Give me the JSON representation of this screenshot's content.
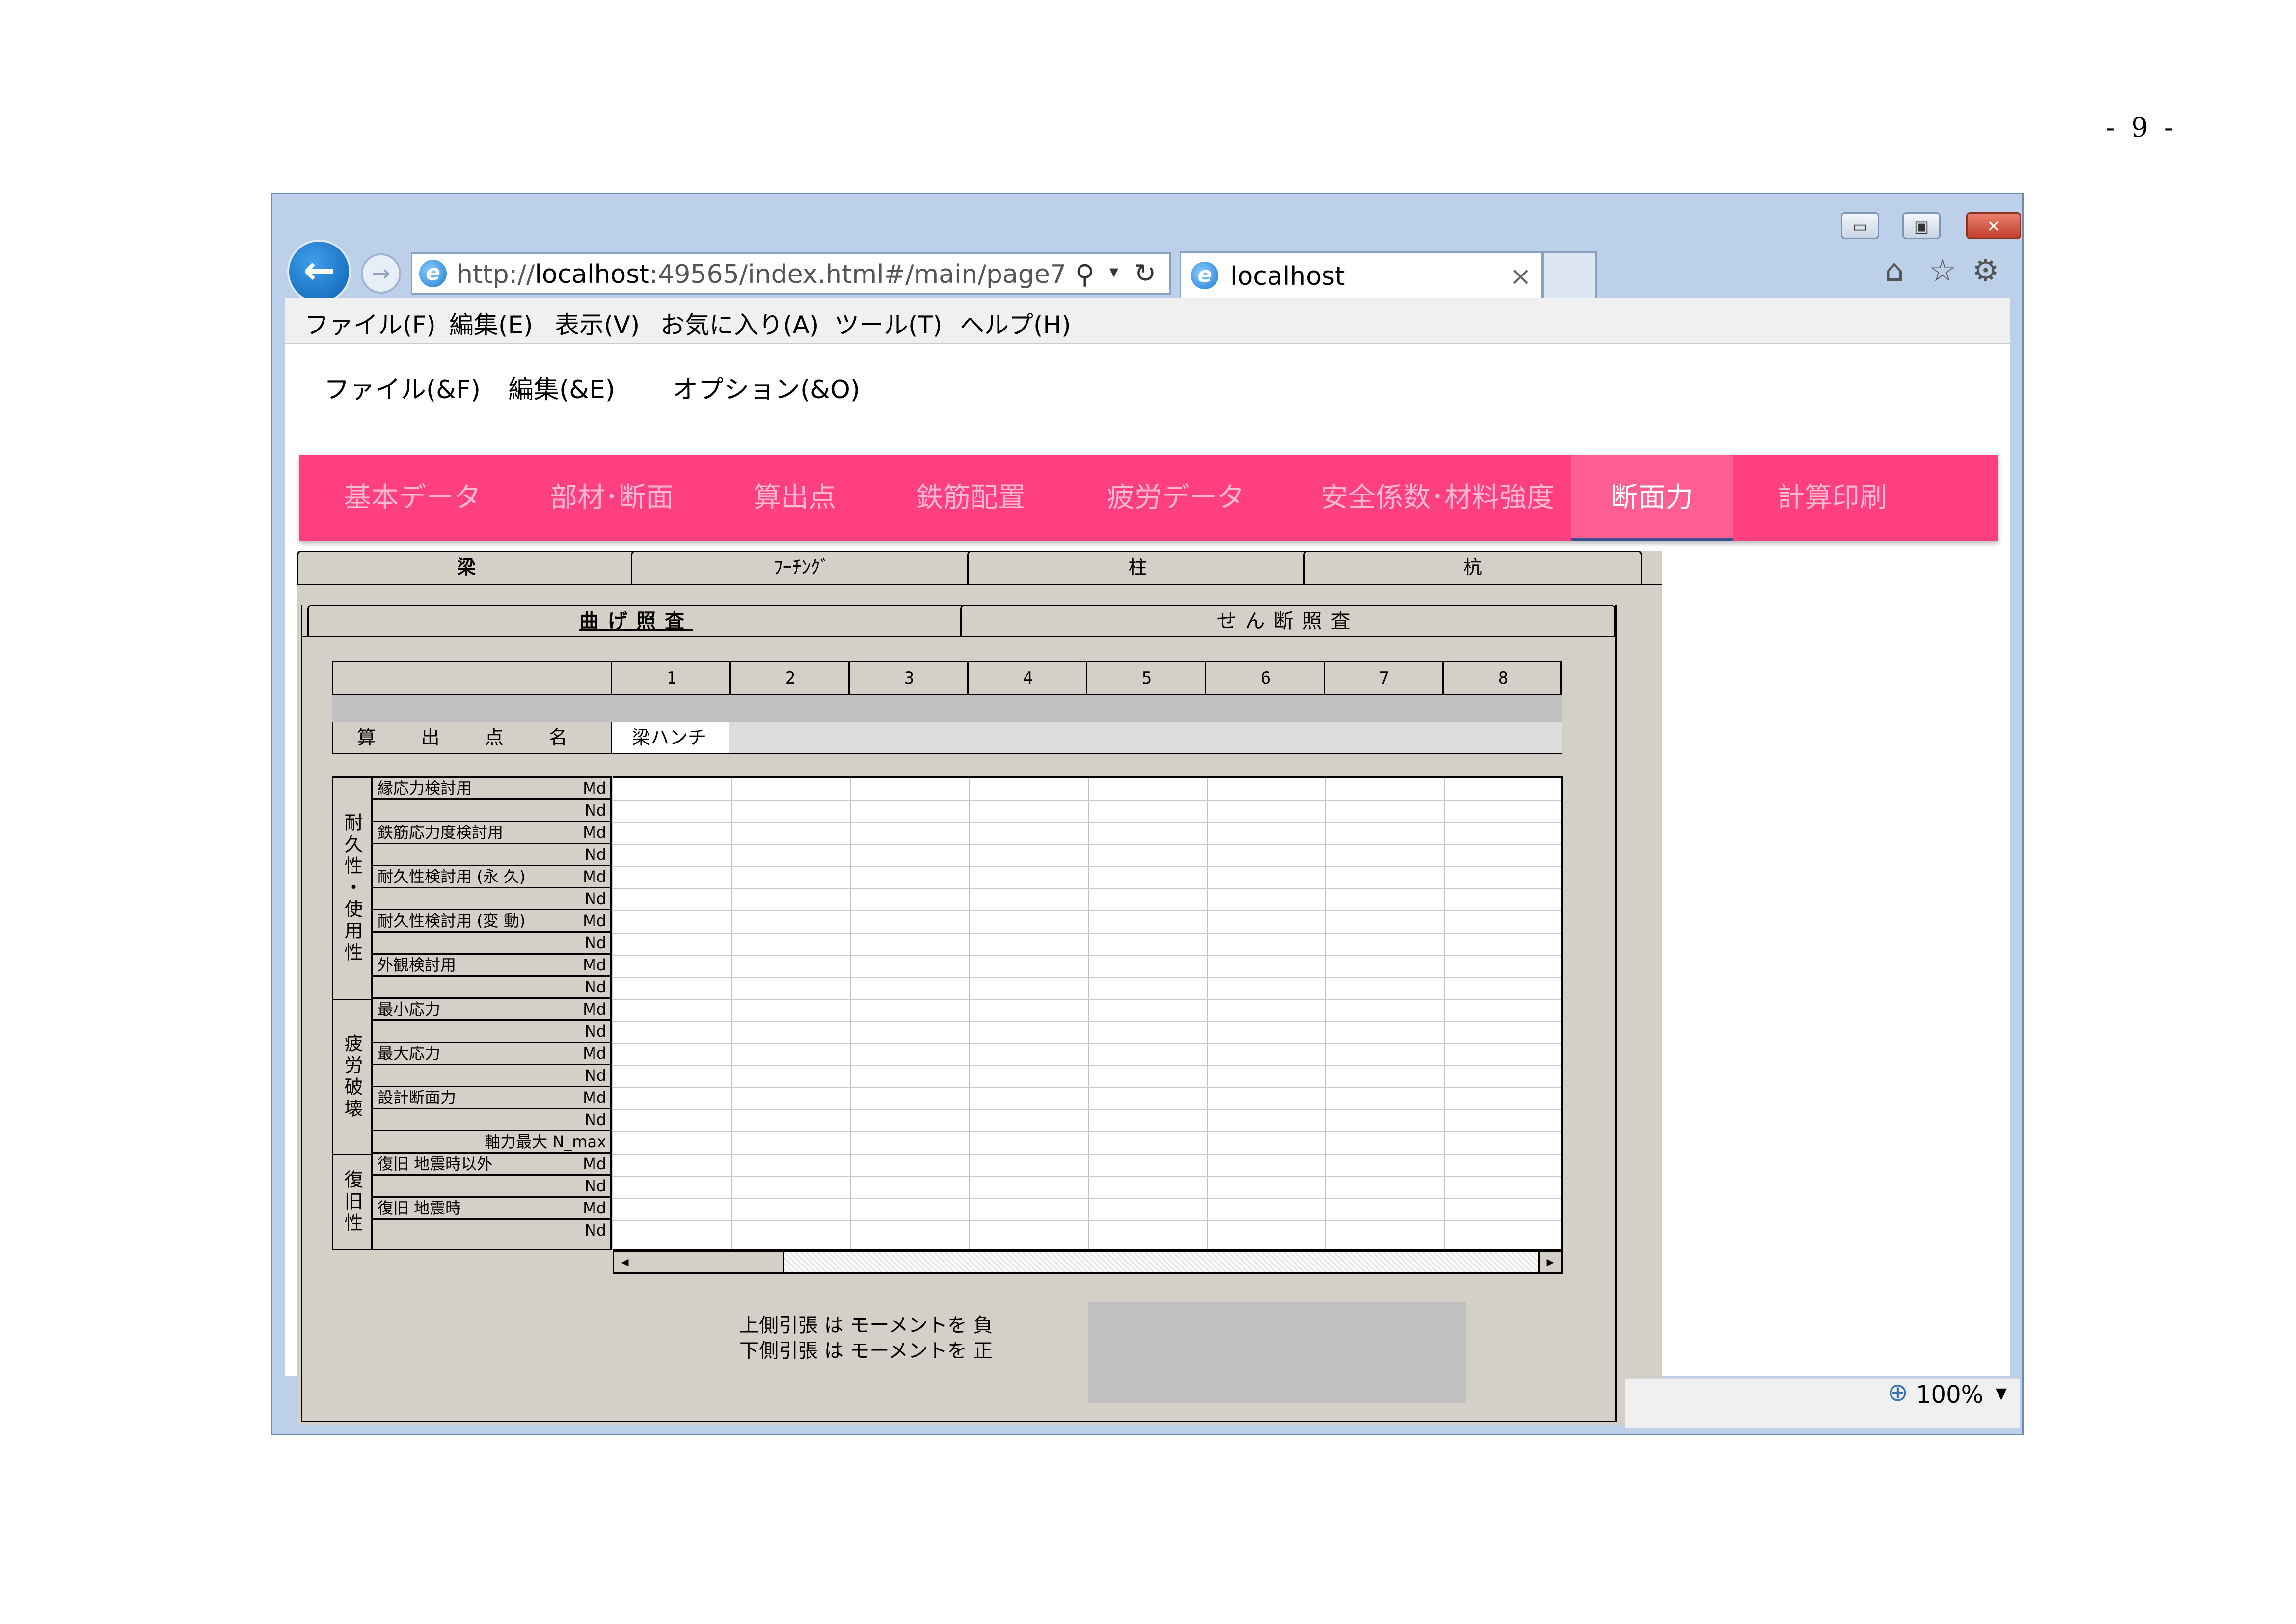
{
  "page_number": "- 9 -",
  "browser": {
    "url_prefix": "http://",
    "url_host": "localhost",
    "url_rest": ":49565/index.html#/main/page7",
    "tab_title": "localhost",
    "tab_close": "×",
    "ie_glyph": "e",
    "back_glyph": "←",
    "forward_glyph": "→",
    "search_glyph": "⚲",
    "dropdown_glyph": "▾",
    "refresh_glyph": "↻",
    "home_glyph": "⌂",
    "star_glyph": "☆",
    "gear_glyph": "⚙",
    "window_controls": {
      "minimize": "▭",
      "maximize": "▣",
      "close": "✕"
    },
    "menu": [
      "ファイル(F)",
      "編集(E)",
      "表示(V)",
      "お気に入り(A)",
      "ツール(T)",
      "ヘルプ(H)"
    ],
    "zoom": "100%",
    "zoom_glyph": "⊕",
    "zoom_dropdown": "▼"
  },
  "app": {
    "menu": [
      "ファイル(&F)",
      "編集(&E)",
      "オプション(&O)"
    ],
    "nav": [
      "基本データ",
      "部材･断面",
      "算出点",
      "鉄筋配置",
      "疲労データ",
      "安全係数･材料強度",
      "断面力",
      "計算印刷"
    ],
    "nav_active_index": 6,
    "member_tabs": [
      "梁",
      "ﾌｰﾁﾝｸﾞ",
      "柱",
      "杭"
    ],
    "check_tabs": [
      "曲げ照査",
      "せん断照査"
    ],
    "columns": [
      "1",
      "2",
      "3",
      "4",
      "5",
      "6",
      "7",
      "8"
    ],
    "calc_point_label": "算 出 点 名",
    "calc_point_values": [
      "梁ハンチ",
      "",
      "",
      "",
      "",
      "",
      "",
      ""
    ],
    "groups": [
      {
        "label": "耐久性・使用性",
        "rows": 10
      },
      {
        "label": "疲労破壊",
        "rows": 7
      },
      {
        "label": "復旧性",
        "rows": 4
      }
    ],
    "rows": [
      {
        "label": "縁応力検討用",
        "unit": "Md"
      },
      {
        "label": "",
        "unit": "Nd"
      },
      {
        "label": "鉄筋応力度検討用",
        "unit": "Md"
      },
      {
        "label": "",
        "unit": "Nd"
      },
      {
        "label": "耐久性検討用 (永 久)",
        "unit": "Md"
      },
      {
        "label": "",
        "unit": "Nd"
      },
      {
        "label": "耐久性検討用 (変 動)",
        "unit": "Md"
      },
      {
        "label": "",
        "unit": "Nd"
      },
      {
        "label": "外観検討用",
        "unit": "Md"
      },
      {
        "label": "",
        "unit": "Nd"
      },
      {
        "label": "最小応力",
        "unit": "Md"
      },
      {
        "label": "",
        "unit": "Nd"
      },
      {
        "label": "最大応力",
        "unit": "Md"
      },
      {
        "label": "",
        "unit": "Nd"
      },
      {
        "label": "設計断面力",
        "unit": "Md"
      },
      {
        "label": "",
        "unit": "Nd"
      },
      {
        "label": "",
        "unit": "軸力最大 N_max"
      },
      {
        "label": "復旧 地震時以外",
        "unit": "Md"
      },
      {
        "label": "",
        "unit": "Nd"
      },
      {
        "label": "復旧 地震時",
        "unit": "Md"
      },
      {
        "label": "",
        "unit": "Nd"
      }
    ],
    "scroll_left": "◂",
    "scroll_right": "▸",
    "note_line1": "上側引張 は モーメントを 負",
    "note_line2": "下側引張 は モーメントを 正"
  },
  "colors": {
    "nav_bg": "#ff3f7f",
    "nav_active": "#ff5e93",
    "panel": "#d4d0c8"
  }
}
